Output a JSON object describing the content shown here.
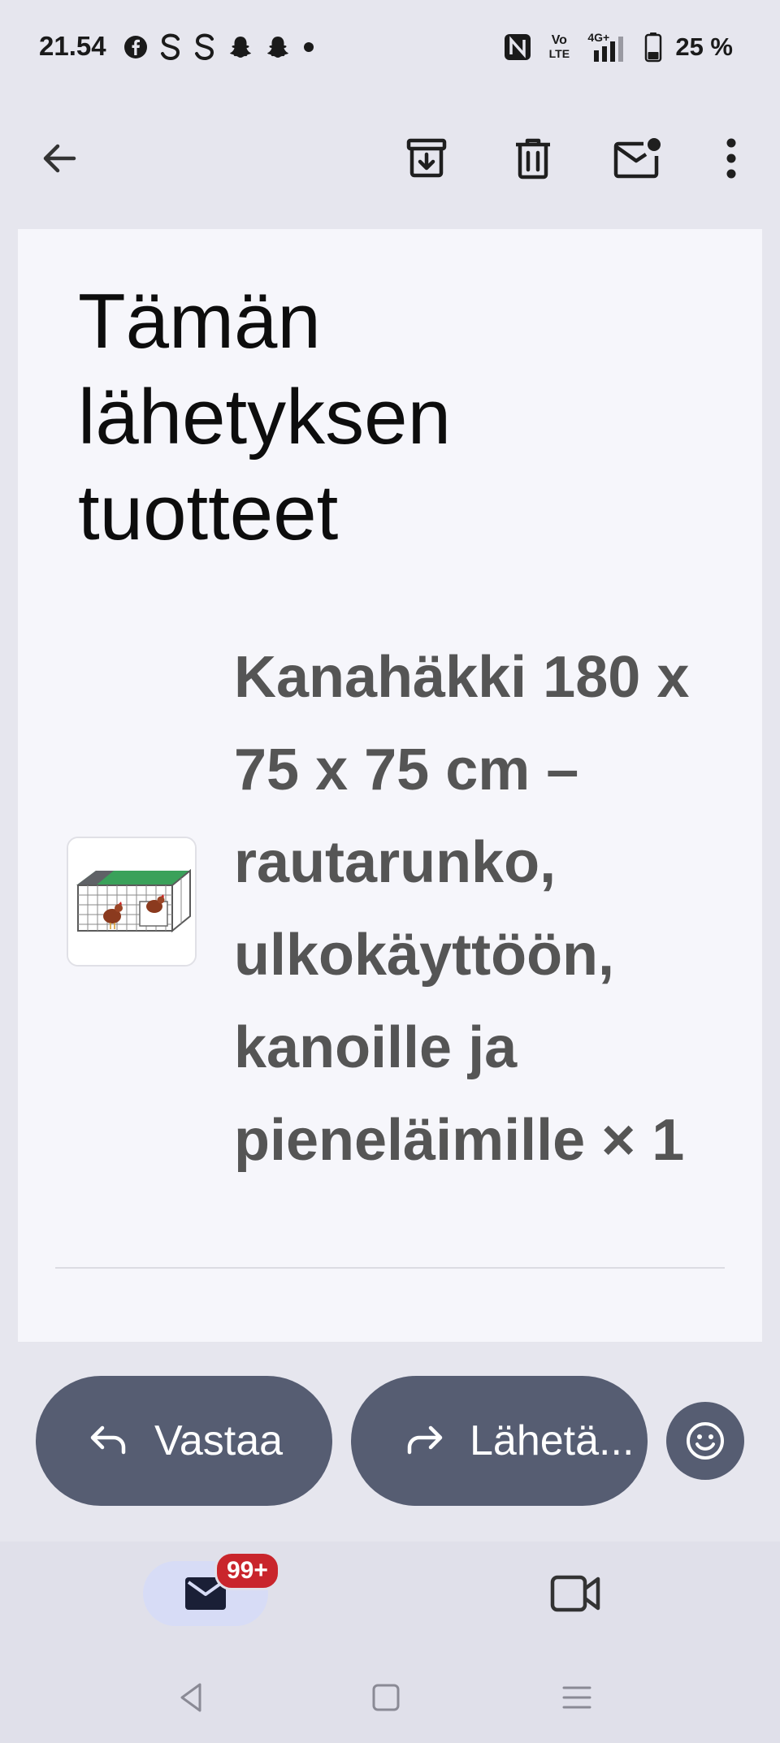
{
  "status_bar": {
    "time": "21.54",
    "left_icons": [
      "facebook-icon",
      "s-app-icon",
      "s-app-icon",
      "snapchat-icon",
      "snapchat-icon",
      "dot-icon"
    ],
    "right_icons": [
      "nfc-icon",
      "volte-icon",
      "signal-4g-icon",
      "battery-icon"
    ],
    "network_label": "4G+",
    "volte_label_top": "Vo",
    "volte_label_bottom": "LTE",
    "battery_percent": "25 %"
  },
  "toolbar": {
    "back_icon": "arrow-back-icon",
    "archive_icon": "archive-icon",
    "delete_icon": "trash-icon",
    "mark_unread_icon": "mail-unread-icon",
    "more_icon": "more-vert-icon"
  },
  "email": {
    "section_title": "Tämän lähetyksen tuotteet",
    "product_title": "Kanahäkki 180 x 75 x 75 cm – rautarunko, ulkokäyttöön, kanoille ja pieneläimille × 1"
  },
  "actions": {
    "reply_label": "Vastaa",
    "forward_label": "Lähetä..."
  },
  "bottom_nav": {
    "mail_badge": "99+",
    "mail_icon": "mail-icon",
    "meet_icon": "video-camera-icon"
  },
  "colors": {
    "action_button_bg": "#565d72",
    "card_bg": "#f6f6fb",
    "badge_bg": "#c9252c",
    "nav_pill_bg": "#d7dcf6"
  }
}
